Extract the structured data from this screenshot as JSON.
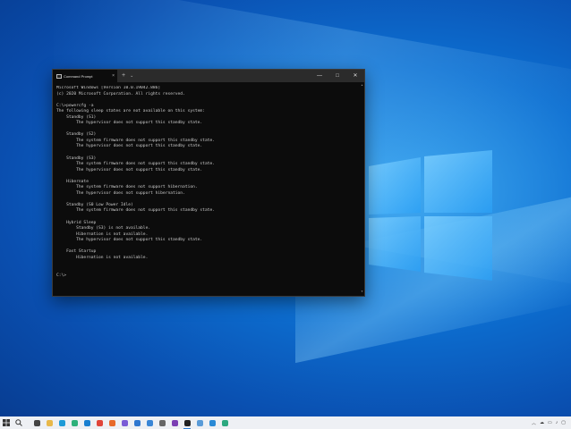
{
  "window": {
    "tab_title": "Command Prompt",
    "tab_close": "×",
    "new_tab": "+",
    "dropdown": "⌄",
    "minimize": "—",
    "maximize": "□",
    "close": "✕"
  },
  "console_lines": [
    "Microsoft Windows [Version 10.0.19042.886]",
    "(c) 2020 Microsoft Corporation. All rights reserved.",
    "",
    "C:\\>powercfg -a",
    "The following sleep states are not available on this system:",
    "    Standby (S1)",
    "        The hypervisor does not support this standby state.",
    "",
    "    Standby (S2)",
    "        The system firmware does not support this standby state.",
    "        The hypervisor does not support this standby state.",
    "",
    "    Standby (S3)",
    "        The system firmware does not support this standby state.",
    "        The hypervisor does not support this standby state.",
    "",
    "    Hibernate",
    "        The system firmware does not support hibernation.",
    "        The hypervisor does not support hibernation.",
    "",
    "    Standby (S0 Low Power Idle)",
    "        The system firmware does not support this standby state.",
    "",
    "    Hybrid Sleep",
    "        Standby (S3) is not available.",
    "        Hibernation is not available.",
    "        The hypervisor does not support this standby state.",
    "",
    "    Fast Startup",
    "        Hibernation is not available.",
    "",
    "",
    "C:\\>"
  ],
  "taskbar": {
    "apps": [
      {
        "name": "task-view",
        "color": "#444444"
      },
      {
        "name": "file-explorer",
        "color": "#e8b84a"
      },
      {
        "name": "edge",
        "color": "#1e9bd7"
      },
      {
        "name": "edge-dev",
        "color": "#2db07a"
      },
      {
        "name": "edge-beta",
        "color": "#1a7fd0"
      },
      {
        "name": "chrome",
        "color": "#e0453a"
      },
      {
        "name": "firefox",
        "color": "#e86a2a"
      },
      {
        "name": "store",
        "color": "#7a5bd6"
      },
      {
        "name": "mail",
        "color": "#2f77cf"
      },
      {
        "name": "photos",
        "color": "#3a86d6"
      },
      {
        "name": "settings",
        "color": "#666666"
      },
      {
        "name": "onenote",
        "color": "#7b3fb3"
      },
      {
        "name": "terminal",
        "color": "#222222"
      },
      {
        "name": "snip",
        "color": "#5a9bd8"
      },
      {
        "name": "vscode",
        "color": "#2a8ad6"
      },
      {
        "name": "edge-canary",
        "color": "#2ca87f"
      }
    ],
    "active_app": "terminal"
  },
  "tray_icons": [
    "chevron-up-icon",
    "cloud-icon",
    "network-icon",
    "volume-icon",
    "notification-icon"
  ]
}
